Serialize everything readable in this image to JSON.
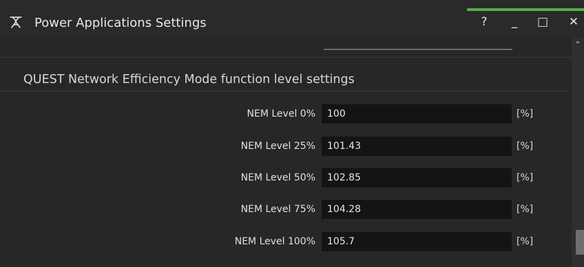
{
  "window": {
    "title": "Power Applications Settings",
    "help_label": "?",
    "minimize_label": "_",
    "maximize_label": "□",
    "close_label": "✕",
    "app_icon_glyph": "ℼ",
    "accent_color": "#52b043"
  },
  "section": {
    "title": "QUEST Network Efficiency Mode function level settings"
  },
  "rows": [
    {
      "label": "NEM Level 0%",
      "value": "100",
      "unit": "[%]"
    },
    {
      "label": "NEM Level 25%",
      "value": "101.43",
      "unit": "[%]"
    },
    {
      "label": "NEM Level 50%",
      "value": "102.85",
      "unit": "[%]"
    },
    {
      "label": "NEM Level 75%",
      "value": "104.28",
      "unit": "[%]"
    },
    {
      "label": "NEM Level 100%",
      "value": "105.7",
      "unit": "[%]"
    }
  ],
  "scrollbar": {
    "up_arrow": "⌃"
  }
}
